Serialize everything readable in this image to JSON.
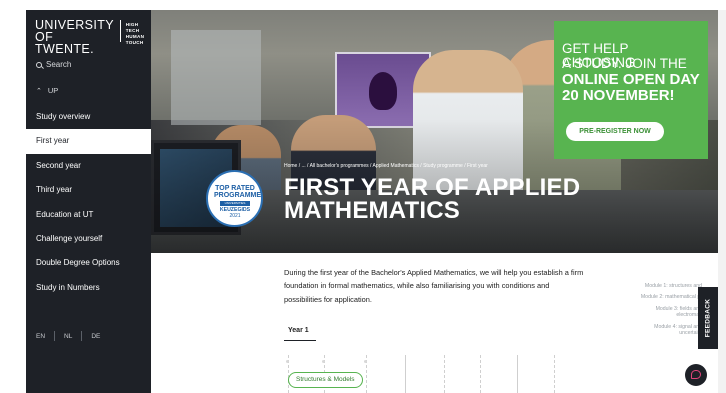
{
  "sidebar": {
    "logo": {
      "name_line1": "UNIVERSITY",
      "name_line2": "OF TWENTE.",
      "tag_line1": "HIGH TECH",
      "tag_line2": "HUMAN TOUCH"
    },
    "search_label": "Search",
    "up_label": "UP",
    "items": [
      {
        "label": "Study overview",
        "active": false
      },
      {
        "label": "First year",
        "active": true
      },
      {
        "label": "Second year",
        "active": false
      },
      {
        "label": "Third year",
        "active": false
      },
      {
        "label": "Education at UT",
        "active": false
      },
      {
        "label": "Challenge yourself",
        "active": false
      },
      {
        "label": "Double Degree Options",
        "active": false
      },
      {
        "label": "Study in Numbers",
        "active": false
      }
    ],
    "languages": [
      "EN",
      "NL",
      "DE"
    ]
  },
  "hero": {
    "breadcrumb": "Home  /  ...  /  All bachelor's programmes  /  Applied Mathematics  /  Study programme  /  First year",
    "title": "FIRST YEAR OF APPLIED MATHEMATICS",
    "badge": {
      "top": "TOP RATED PROGRAMME",
      "brand": "UNIVERSITIES",
      "name": "KEUZEGIDS",
      "year": "2021"
    }
  },
  "promo": {
    "line1": "GET HELP CHOOSING",
    "line2": "A STUDY. JOIN THE",
    "line3": "ONLINE OPEN DAY",
    "line4": "20 NOVEMBER!",
    "button": "PRE-REGISTER NOW"
  },
  "content": {
    "intro": "During the first year of the Bachelor's Applied Mathematics, we will help you establish a firm foundation in formal mathematics, while also familiarising you with conditions and possibilities for application.",
    "tab": "Year 1",
    "module_pill": "Structures & Models"
  },
  "side_modules": [
    "Module 1: structures and",
    "Module 2: mathematical pr",
    "Module 3: fields and electromag",
    "Module 4: signal and uncertaint"
  ],
  "feedback_label": "FEEDBACK",
  "colors": {
    "sidebar_bg": "#1e2127",
    "brand_green": "#58b450",
    "badge_blue": "#1d5fa5"
  }
}
